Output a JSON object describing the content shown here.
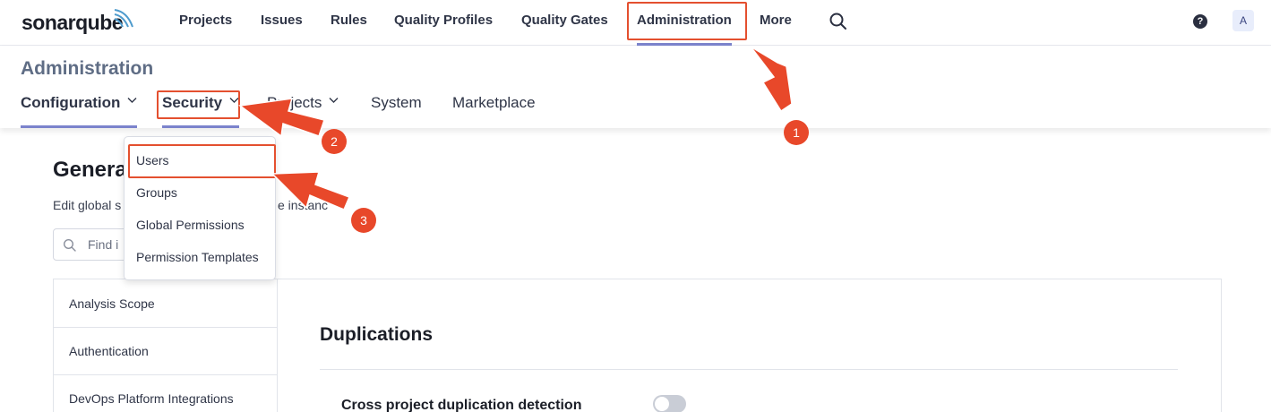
{
  "brand": {
    "logo_text": "sonarqube",
    "accent": "#7b83cc"
  },
  "topnav": {
    "items": [
      {
        "label": "Projects"
      },
      {
        "label": "Issues"
      },
      {
        "label": "Rules"
      },
      {
        "label": "Quality Profiles"
      },
      {
        "label": "Quality Gates"
      },
      {
        "label": "Administration"
      },
      {
        "label": "More"
      }
    ],
    "help_label": "?",
    "avatar_initial": "A",
    "search_icon": "search-icon"
  },
  "admin": {
    "title": "Administration",
    "subnav": [
      {
        "label": "Configuration"
      },
      {
        "label": "Security"
      },
      {
        "label": "Projects"
      },
      {
        "label": "System"
      },
      {
        "label": "Marketplace"
      }
    ]
  },
  "security_menu": {
    "items": [
      {
        "label": "Users"
      },
      {
        "label": "Groups"
      },
      {
        "label": "Global Permissions"
      },
      {
        "label": "Permission Templates"
      }
    ]
  },
  "general": {
    "title": "Genera",
    "description_visible_left": "Edit global s",
    "description_visible_right": "e instanc",
    "search_placeholder": "Find i",
    "categories": [
      {
        "label": "Analysis Scope"
      },
      {
        "label": "Authentication"
      },
      {
        "label": "DevOps Platform Integrations"
      }
    ]
  },
  "panel": {
    "section_title": "Duplications",
    "setting_label": "Cross project duplication detection",
    "toggle_on": false
  },
  "annotations": {
    "highlight_color": "#e4502f",
    "badges": [
      "1",
      "2",
      "3"
    ]
  }
}
